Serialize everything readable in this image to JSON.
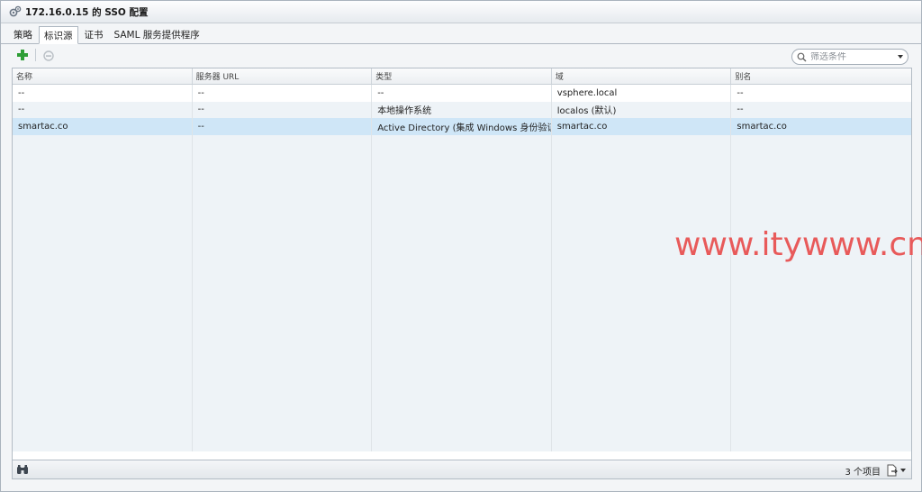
{
  "window": {
    "title": "172.16.0.15 的 SSO 配置"
  },
  "tabs": [
    {
      "label": "策略"
    },
    {
      "label": "标识源"
    },
    {
      "label": "证书"
    },
    {
      "label": "SAML 服务提供程序"
    }
  ],
  "toolbar": {
    "add_icon": "plus-icon",
    "delete_icon": "remove-icon",
    "filter_placeholder": "筛选条件"
  },
  "table": {
    "columns": [
      "名称",
      "服务器 URL",
      "类型",
      "域",
      "别名"
    ],
    "rows": [
      [
        "--",
        "--",
        "--",
        "vsphere.local",
        "--"
      ],
      [
        "--",
        "--",
        "本地操作系统",
        "localos (默认)",
        "--"
      ],
      [
        "smartac.co",
        "--",
        "Active Directory (集成 Windows 身份验证)",
        "smartac.co",
        "smartac.co"
      ]
    ],
    "selected_row": 2
  },
  "statusbar": {
    "count_label": "3 个项目"
  },
  "watermark": "www.itywww.cn",
  "colors": {
    "accent": "#cfe6f7",
    "add_green": "#2e9e36",
    "watermark": "#e85a5a"
  }
}
